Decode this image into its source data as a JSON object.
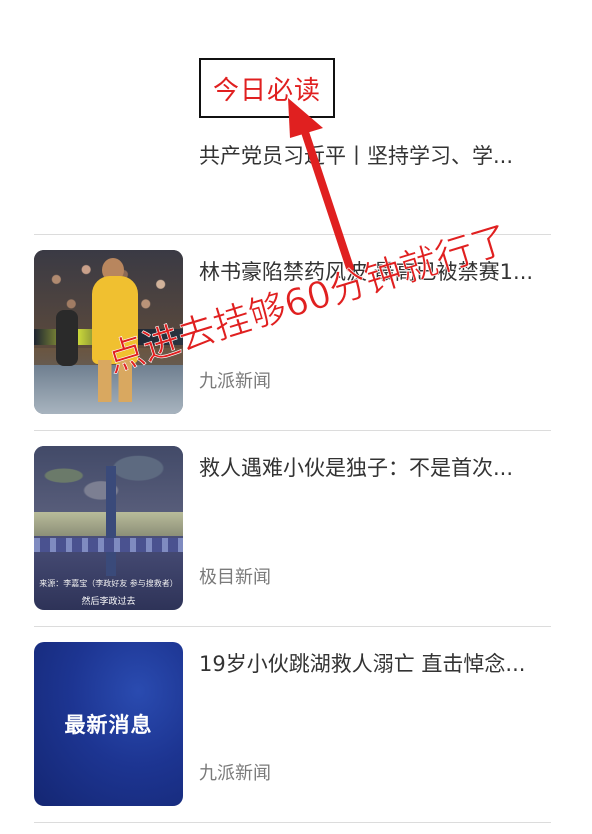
{
  "top_card": {
    "badge_label": "今日必读",
    "title": "共产党员习近平丨坚持学习、学..."
  },
  "news": [
    {
      "title": "林书豪陷禁药风波 最高已被禁赛1...",
      "source": "九派新闻",
      "thumb_icon": "basketball-player-photo"
    },
    {
      "title": "救人遇难小伙是独子：不是首次...",
      "source": "极目新闻",
      "thumb_icon": "night-riverside-video-still",
      "thumb_caption_line1": "来源：李嘉宝（李政好友 参与搜救者）",
      "thumb_caption_line2": "然后李政过去"
    },
    {
      "title": "19岁小伙跳湖救人溺亡 直击悼念...",
      "source": "九派新闻",
      "thumb_label": "最新消息"
    }
  ],
  "annotation": {
    "text": "点进去挂够60分钟就行了",
    "color": "#e02020"
  }
}
